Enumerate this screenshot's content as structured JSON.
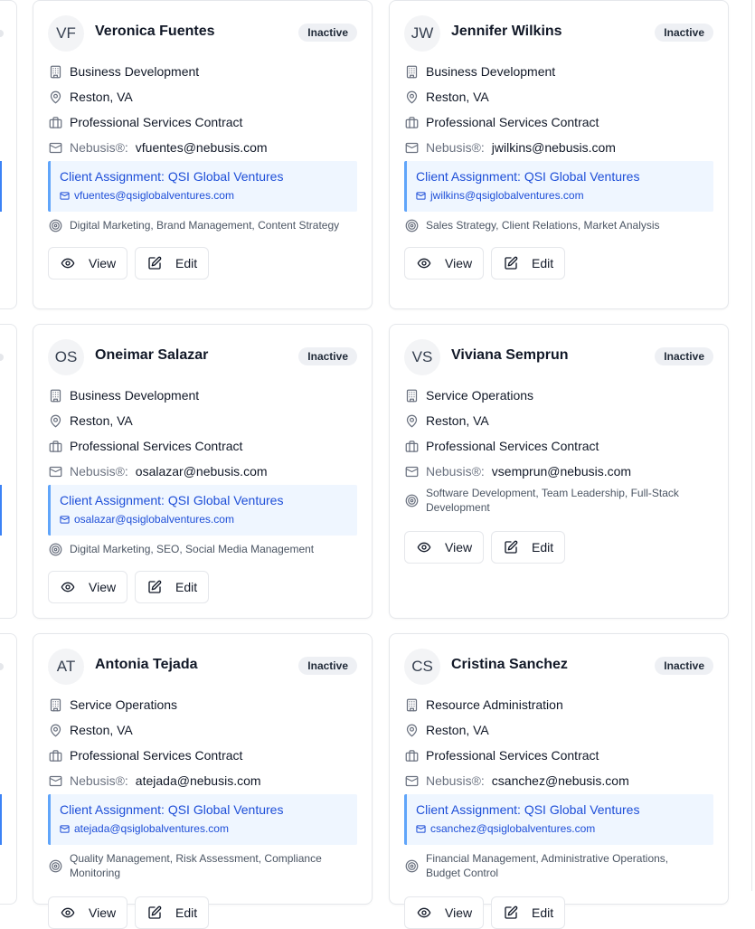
{
  "labels": {
    "nebusis": "Nebusis®:",
    "view": "View",
    "edit": "Edit"
  },
  "employees": [
    {
      "initials": "VF",
      "name": "Veronica Fuentes",
      "status": "Inactive",
      "department": "Business Development",
      "location": "Reston, VA",
      "contract": "Professional Services Contract",
      "email": "vfuentes@nebusis.com",
      "client_assignment": "Client Assignment: QSI Global Ventures",
      "client_email": "vfuentes@qsiglobalventures.com",
      "skills": "Digital Marketing, Brand Management, Content Strategy"
    },
    {
      "initials": "JW",
      "name": "Jennifer Wilkins",
      "status": "Inactive",
      "department": "Business Development",
      "location": "Reston, VA",
      "contract": "Professional Services Contract",
      "email": "jwilkins@nebusis.com",
      "client_assignment": "Client Assignment: QSI Global Ventures",
      "client_email": "jwilkins@qsiglobalventures.com",
      "skills": "Sales Strategy, Client Relations, Market Analysis"
    },
    {
      "initials": "OS",
      "name": "Oneimar Salazar",
      "status": "Inactive",
      "department": "Business Development",
      "location": "Reston, VA",
      "contract": "Professional Services Contract",
      "email": "osalazar@nebusis.com",
      "client_assignment": "Client Assignment: QSI Global Ventures",
      "client_email": "osalazar@qsiglobalventures.com",
      "skills": "Digital Marketing, SEO, Social Media Management"
    },
    {
      "initials": "VS",
      "name": "Viviana Semprun",
      "status": "Inactive",
      "department": "Service Operations",
      "location": "Reston, VA",
      "contract": "Professional Services Contract",
      "email": "vsemprun@nebusis.com",
      "skills": "Software Development, Team Leadership, Full-Stack Development"
    },
    {
      "initials": "AT",
      "name": "Antonia Tejada",
      "status": "Inactive",
      "department": "Service Operations",
      "location": "Reston, VA",
      "contract": "Professional Services Contract",
      "email": "atejada@nebusis.com",
      "client_assignment": "Client Assignment: QSI Global Ventures",
      "client_email": "atejada@qsiglobalventures.com",
      "skills": "Quality Management, Risk Assessment, Compliance Monitoring"
    },
    {
      "initials": "CS",
      "name": "Cristina Sanchez",
      "status": "Inactive",
      "department": "Resource Administration",
      "location": "Reston, VA",
      "contract": "Professional Services Contract",
      "email": "csanchez@nebusis.com",
      "client_assignment": "Client Assignment: QSI Global Ventures",
      "client_email": "csanchez@qsiglobalventures.com",
      "skills": "Financial Management, Administrative Operations, Budget Control"
    }
  ],
  "colors": {
    "accent": "#1d4ed8",
    "client_bg": "#eff6ff",
    "client_border": "#60a5fa",
    "badge_bg": "#eef0f4",
    "card_border": "#e5e7eb"
  }
}
